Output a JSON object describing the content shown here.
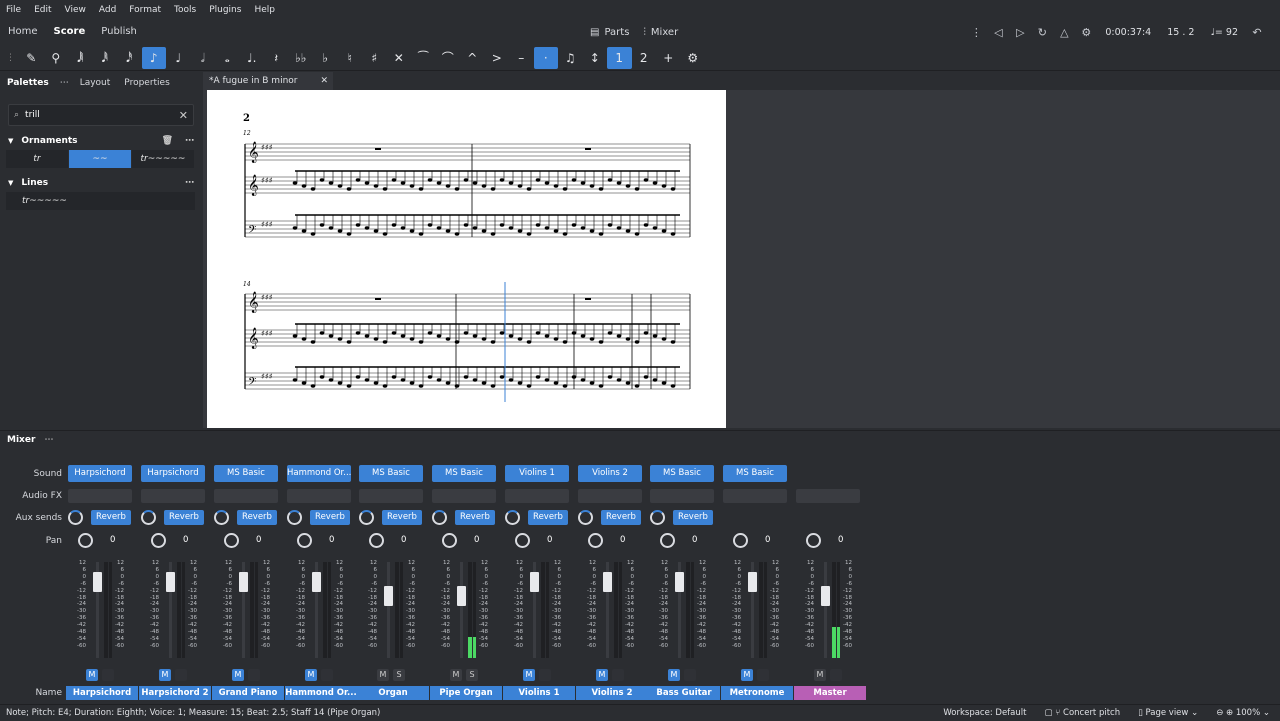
{
  "menu": [
    "File",
    "Edit",
    "View",
    "Add",
    "Format",
    "Tools",
    "Plugins",
    "Help"
  ],
  "nav": {
    "tabs": [
      "Home",
      "Score",
      "Publish"
    ],
    "active": "Score",
    "parts_label": "Parts",
    "mixer_label": "Mixer"
  },
  "playback": {
    "time": "0:00:37:4",
    "position": "15 . 2",
    "tempo": "= 92"
  },
  "toolbar_icons": [
    "pencil-icon",
    "brush-icon",
    "64th-note-icon",
    "32nd-note-icon",
    "16th-note-icon",
    "eighth-note-icon",
    "quarter-note-icon",
    "half-note-icon",
    "whole-note-icon",
    "dotted-note-icon",
    "rest-icon",
    "double-flat-icon",
    "flat-icon",
    "natural-icon",
    "sharp-icon",
    "double-sharp-icon",
    "tie-icon",
    "slur-icon",
    "marcato-icon",
    "accent-icon",
    "tenuto-icon",
    "staccato-icon",
    "tuplet-icon",
    "flip-icon",
    "voice1-icon",
    "voice2-icon",
    "add-icon",
    "settings-icon"
  ],
  "palettes": {
    "tabs": [
      "Palettes",
      "Layout",
      "Properties"
    ],
    "search_value": "trill",
    "ornaments_title": "Ornaments",
    "ornament_cells": [
      "tr",
      "~~",
      "tr~~~~~"
    ],
    "lines_title": "Lines",
    "line_cells": [
      "tr~~~~~"
    ]
  },
  "document_tab": "*A fugue in B minor based...",
  "score": {
    "page_number": "2",
    "measure_a": "12",
    "measure_b": "14"
  },
  "mixer": {
    "title": "Mixer",
    "row_labels": [
      "Sound",
      "Audio FX",
      "Aux sends",
      "Pan",
      "Name"
    ],
    "scale": [
      "12",
      "6",
      "0",
      "-6",
      "-12",
      "-18",
      "-24",
      "-30",
      "-36",
      "-42",
      "-48",
      "-54",
      "-60"
    ],
    "channels": [
      {
        "sound": "Harpsichord",
        "aux": "Reverb",
        "pan": "0",
        "name": "Harpsichord",
        "mute": "M",
        "meter": 0
      },
      {
        "sound": "Harpsichord",
        "aux": "Reverb",
        "pan": "0",
        "name": "Harpsichord 2",
        "mute": "M",
        "meter": 0
      },
      {
        "sound": "MS Basic",
        "aux": "Reverb",
        "pan": "0",
        "name": "Grand Piano",
        "mute": "M",
        "meter": 0
      },
      {
        "sound": "Hammond Or...",
        "aux": "Reverb",
        "pan": "0",
        "name": "Hammond Or...",
        "mute": "M",
        "meter": 0
      },
      {
        "sound": "MS Basic",
        "aux": "Reverb",
        "pan": "0",
        "name": "Organ",
        "mute": "M",
        "solo": "S",
        "meter": 0
      },
      {
        "sound": "MS Basic",
        "aux": "Reverb",
        "pan": "0",
        "name": "Pipe Organ",
        "mute": "M",
        "solo": "S",
        "meter": 0.22
      },
      {
        "sound": "Violins 1",
        "aux": "Reverb",
        "pan": "0",
        "name": "Violins 1",
        "mute": "M",
        "meter": 0
      },
      {
        "sound": "Violins 2",
        "aux": "Reverb",
        "pan": "0",
        "name": "Violins 2",
        "mute": "M",
        "meter": 0
      },
      {
        "sound": "MS Basic",
        "aux": "Reverb",
        "pan": "0",
        "name": "Bass Guitar",
        "mute": "M",
        "meter": 0
      },
      {
        "sound": "MS Basic",
        "pan": "0",
        "name": "Metronome",
        "mute": "M",
        "meter": 0
      },
      {
        "pan": "0",
        "name": "Master",
        "mute": "M",
        "meter": 0.32
      }
    ]
  },
  "status": {
    "text": "Note; Pitch: E4; Duration: Eighth; Voice: 1; Measure: 15; Beat: 2.5; Staff 14 (Pipe Organ)",
    "workspace": "Workspace: Default",
    "concert_pitch": "Concert pitch",
    "view": "Page view",
    "zoom": "100%"
  },
  "colors": {
    "accent": "#3b82d6",
    "master": "#b85fb5",
    "meter": "#4cd964"
  }
}
